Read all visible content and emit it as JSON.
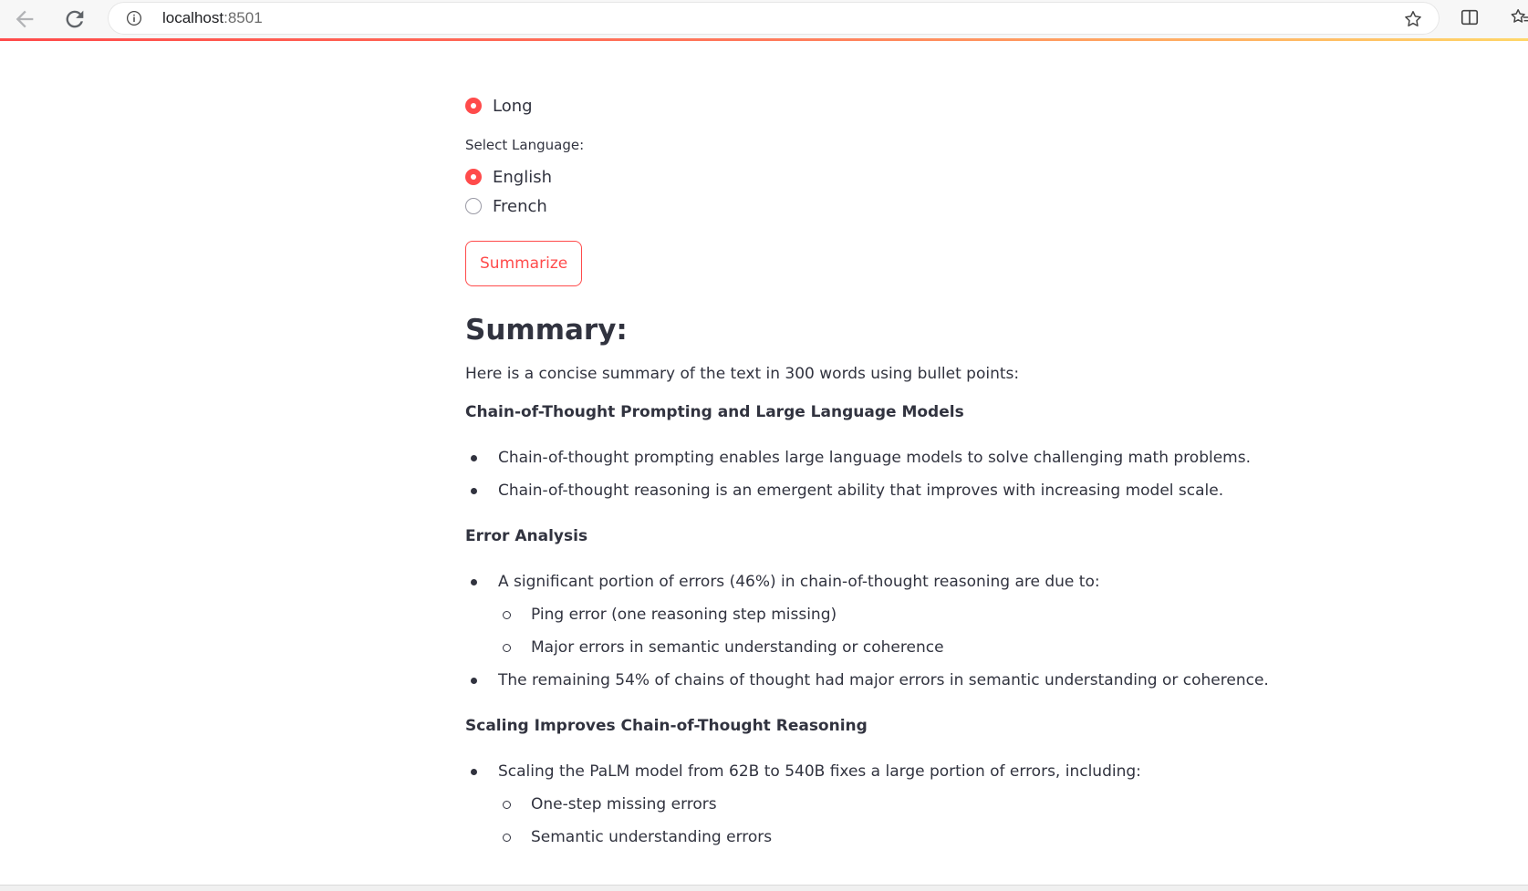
{
  "browser": {
    "url_host": "localhost",
    "url_port": ":8501"
  },
  "length_option": {
    "label": "Long",
    "selected": true
  },
  "language": {
    "label": "Select Language:",
    "options": [
      {
        "label": "English",
        "selected": true
      },
      {
        "label": "French",
        "selected": false
      }
    ]
  },
  "summarize_button": "Summarize",
  "summary": {
    "heading": "Summary:",
    "intro": "Here is a concise summary of the text in 300 words using bullet points:",
    "sections": [
      {
        "title": "Chain-of-Thought Prompting and Large Language Models",
        "bullets": [
          "Chain-of-thought prompting enables large language models to solve challenging math problems.",
          "Chain-of-thought reasoning is an emergent ability that improves with increasing model scale."
        ]
      },
      {
        "title": "Error Analysis",
        "bullets": [
          "A significant portion of errors (46%) in chain-of-thought reasoning are due to:",
          "Ping error (one reasoning step missing)",
          "Major errors in semantic understanding or coherence",
          "The remaining 54% of chains of thought had major errors in semantic understanding or coherence."
        ]
      },
      {
        "title": "Scaling Improves Chain-of-Thought Reasoning",
        "bullets": [
          "Scaling the PaLM model from 62B to 540B fixes a large portion of errors, including:",
          "One-step missing errors",
          "Semantic understanding errors"
        ]
      }
    ]
  },
  "colors": {
    "accent": "#ff4b4b",
    "text": "#31333f"
  }
}
